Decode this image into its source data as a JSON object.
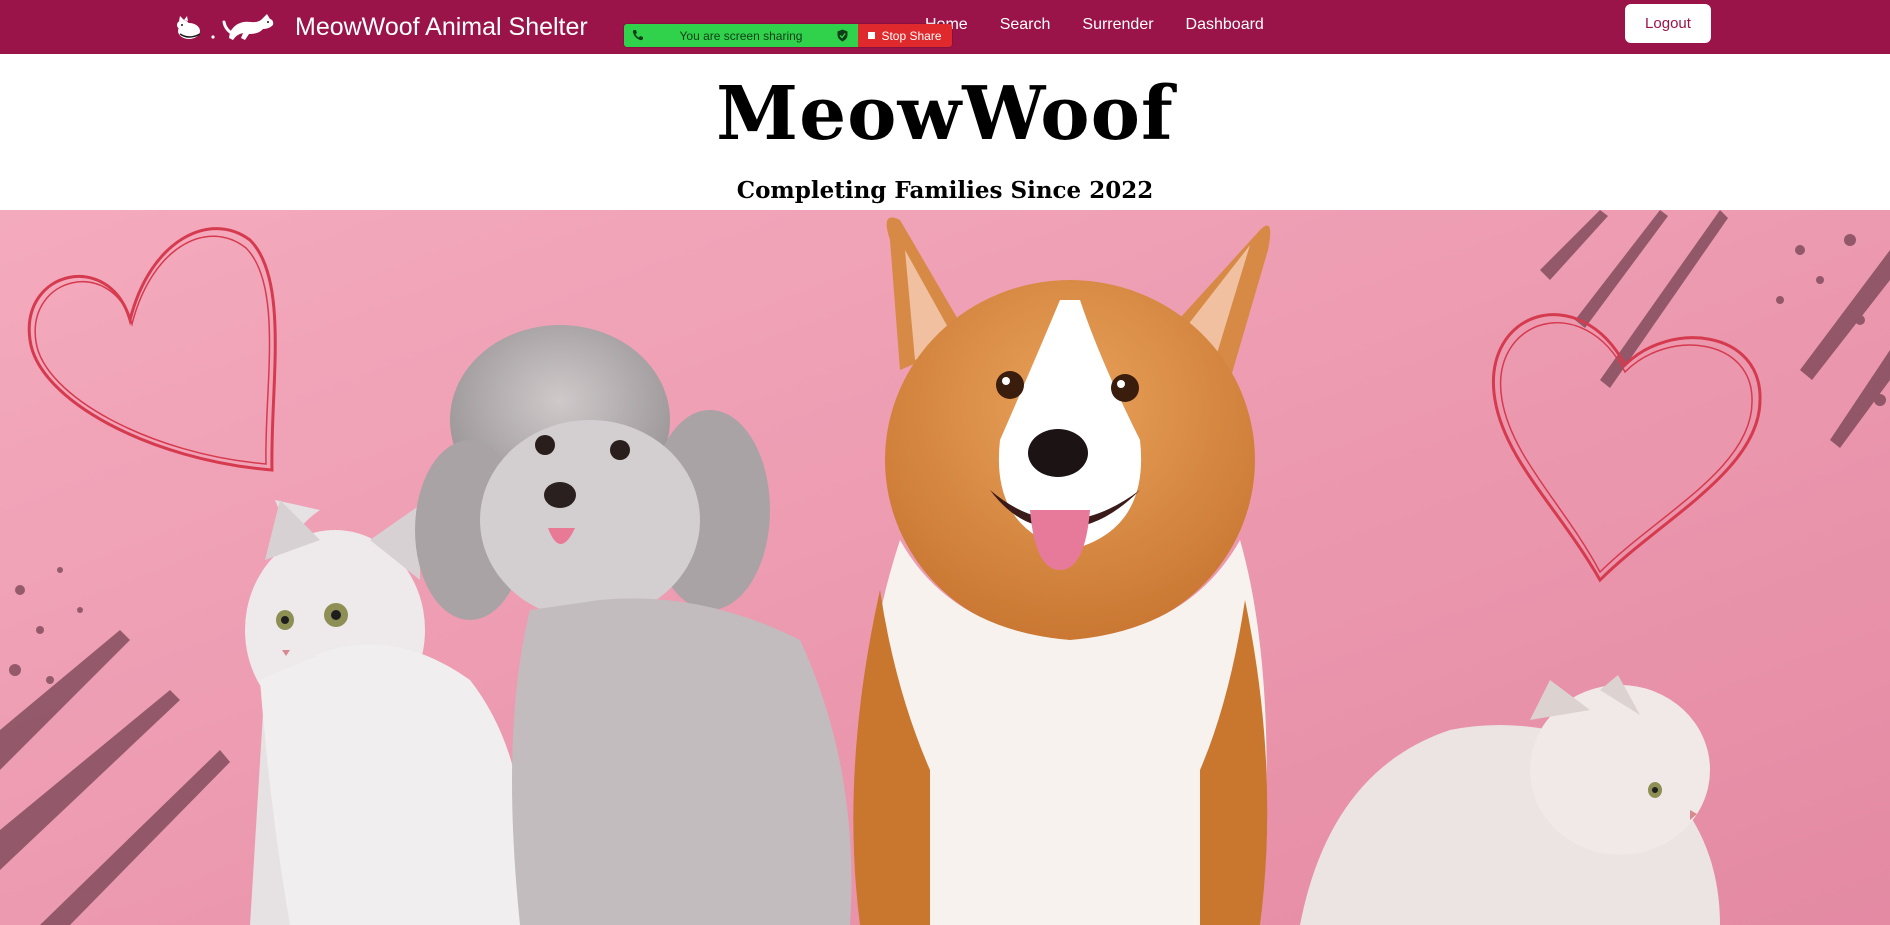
{
  "navbar": {
    "brand_name": "MeowWoof Animal Shelter",
    "links": [
      "Home",
      "Search",
      "Surrender",
      "Dashboard"
    ],
    "logout_label": "Logout"
  },
  "screen_share": {
    "status_text": "You are screen sharing",
    "stop_label": "Stop Share"
  },
  "header": {
    "title": "MeowWoof",
    "tagline": "Completing Families Since 2022"
  },
  "hero": {
    "background_color": "#f1a4b8",
    "heart_color": "#d63a4e"
  },
  "colors": {
    "brand": "#9b1449",
    "share_green": "#2fd24a",
    "share_red": "#e0292c"
  },
  "icons": [
    "cat-dog-logo-icon",
    "phone-icon",
    "shield-check-icon",
    "stop-square-icon"
  ]
}
